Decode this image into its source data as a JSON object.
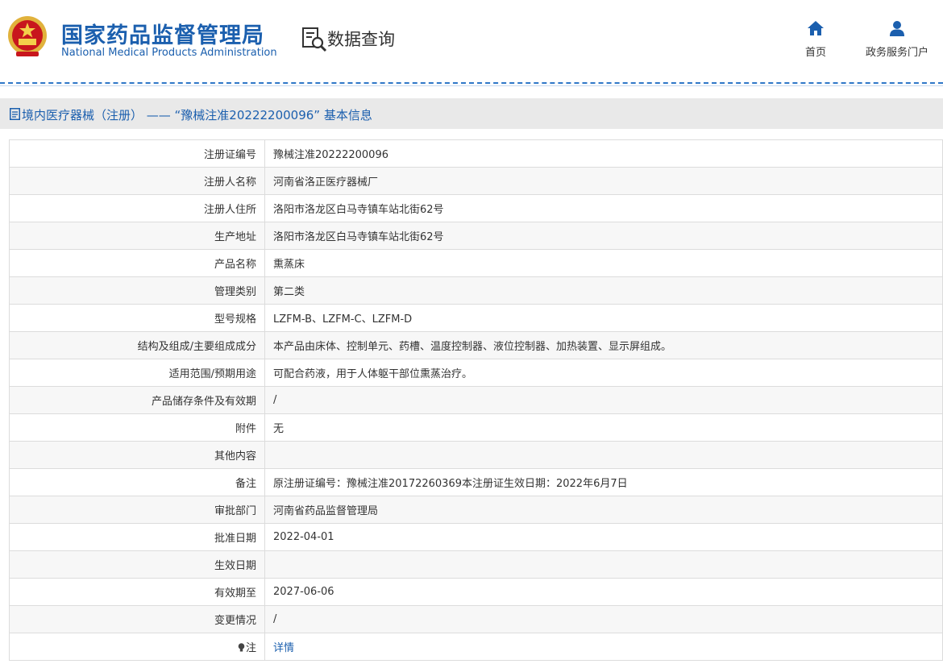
{
  "header": {
    "site_name_cn": "国家药品监督管理局",
    "site_name_en": "National Medical Products Administration",
    "query_title": "数据查询",
    "nav": [
      {
        "label": "首页",
        "icon": "home-icon"
      },
      {
        "label": "政务服务门户",
        "icon": "user-icon"
      }
    ]
  },
  "page": {
    "title": "境内医疗器械（注册） —— “豫械注准20222200096” 基本信息"
  },
  "rows": [
    {
      "label": "注册证编号",
      "value": "豫械注准20222200096"
    },
    {
      "label": "注册人名称",
      "value": "河南省洛正医疗器械厂"
    },
    {
      "label": "注册人住所",
      "value": "洛阳市洛龙区白马寺镇车站北街62号"
    },
    {
      "label": "生产地址",
      "value": "洛阳市洛龙区白马寺镇车站北街62号"
    },
    {
      "label": "产品名称",
      "value": "熏蒸床"
    },
    {
      "label": "管理类别",
      "value": "第二类"
    },
    {
      "label": "型号规格",
      "value": "LZFM-B、LZFM-C、LZFM-D"
    },
    {
      "label": "结构及组成/主要组成成分",
      "value": "本产品由床体、控制单元、药槽、温度控制器、液位控制器、加热装置、显示屏组成。"
    },
    {
      "label": "适用范围/预期用途",
      "value": "可配合药液，用于人体躯干部位熏蒸治疗。"
    },
    {
      "label": "产品储存条件及有效期",
      "value": "/"
    },
    {
      "label": "附件",
      "value": "无"
    },
    {
      "label": "其他内容",
      "value": ""
    },
    {
      "label": "备注",
      "value": "原注册证编号：豫械注准20172260369本注册证生效日期：2022年6月7日"
    },
    {
      "label": "审批部门",
      "value": "河南省药品监督管理局"
    },
    {
      "label": "批准日期",
      "value": "2022-04-01"
    },
    {
      "label": "生效日期",
      "value": ""
    },
    {
      "label": "有效期至",
      "value": "2027-06-06"
    },
    {
      "label": "变更情况",
      "value": "/"
    },
    {
      "label": "注",
      "value": "详情"
    }
  ],
  "colors": {
    "brand_blue": "#1b5fae",
    "title_bar_bg": "#e9e9e9",
    "row_alt_bg": "#f7f7f7"
  }
}
